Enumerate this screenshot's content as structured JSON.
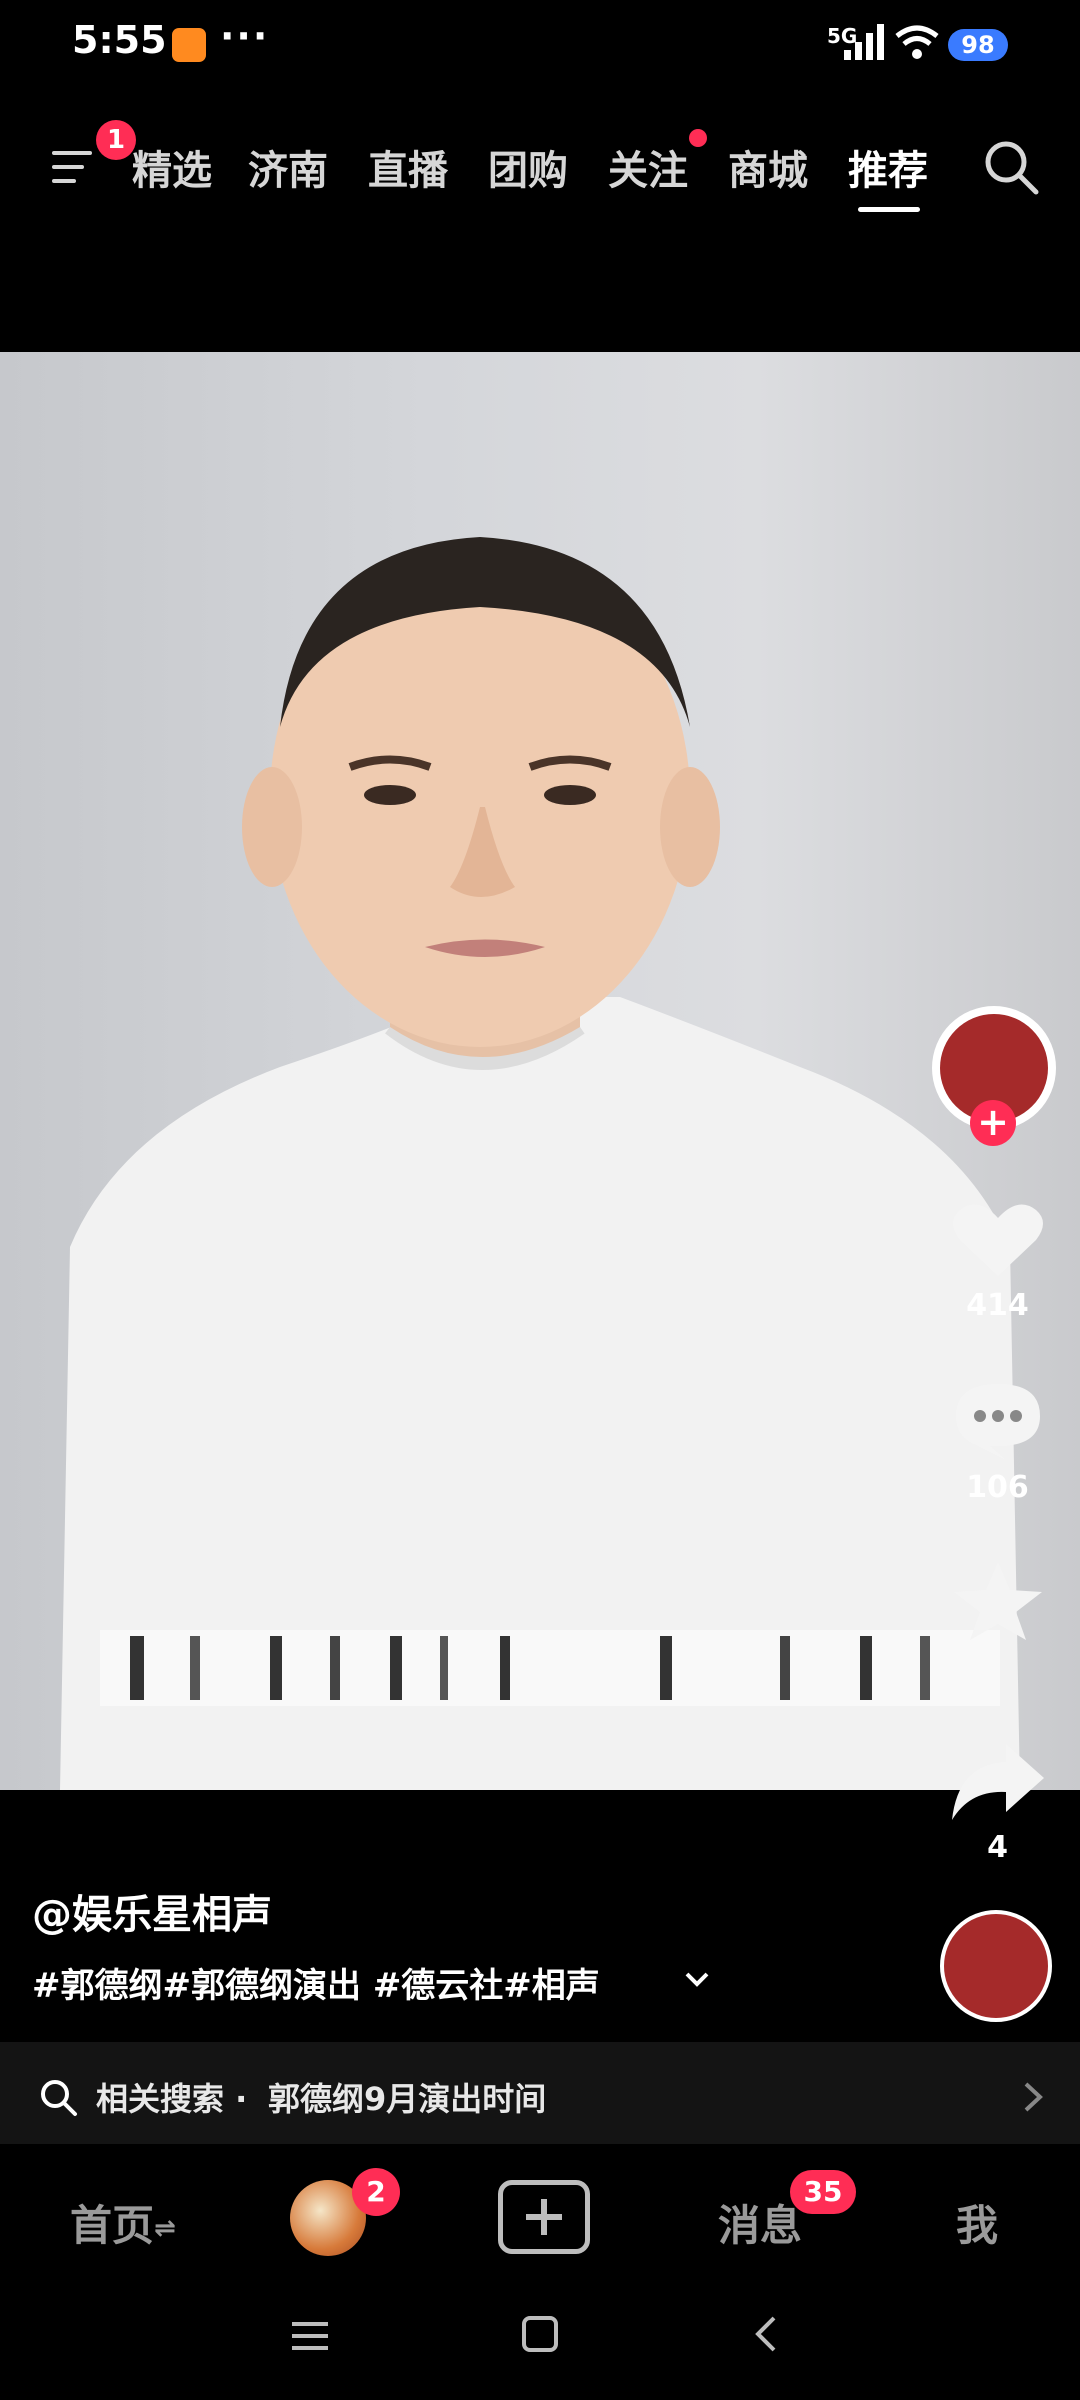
{
  "status_bar": {
    "time": "5:55",
    "dots": "···",
    "network": "5G",
    "battery": "98"
  },
  "top_nav": {
    "menu_badge": "1",
    "tabs": [
      "精选",
      "济南",
      "直播",
      "团购",
      "关注",
      "商城",
      "推荐"
    ],
    "active_tab": "推荐"
  },
  "right_rail": {
    "follow_plus": "+",
    "likes": "414",
    "comments": "106",
    "shares": "4"
  },
  "video_info": {
    "author": "@娱乐星相声",
    "tags": "#郭德纲#郭德纲演出 #德云社#相声"
  },
  "related_search": {
    "prefix": "相关搜索 ·",
    "query": "郭德纲9月演出时间"
  },
  "bottom_nav": {
    "home": "首页",
    "home_suffix": "⇌",
    "friend_badge": "2",
    "messages": "消息",
    "messages_badge": "35",
    "me": "我"
  },
  "colors": {
    "badge": "#ff2d55",
    "battery": "#3a7bff",
    "background": "#000000"
  }
}
